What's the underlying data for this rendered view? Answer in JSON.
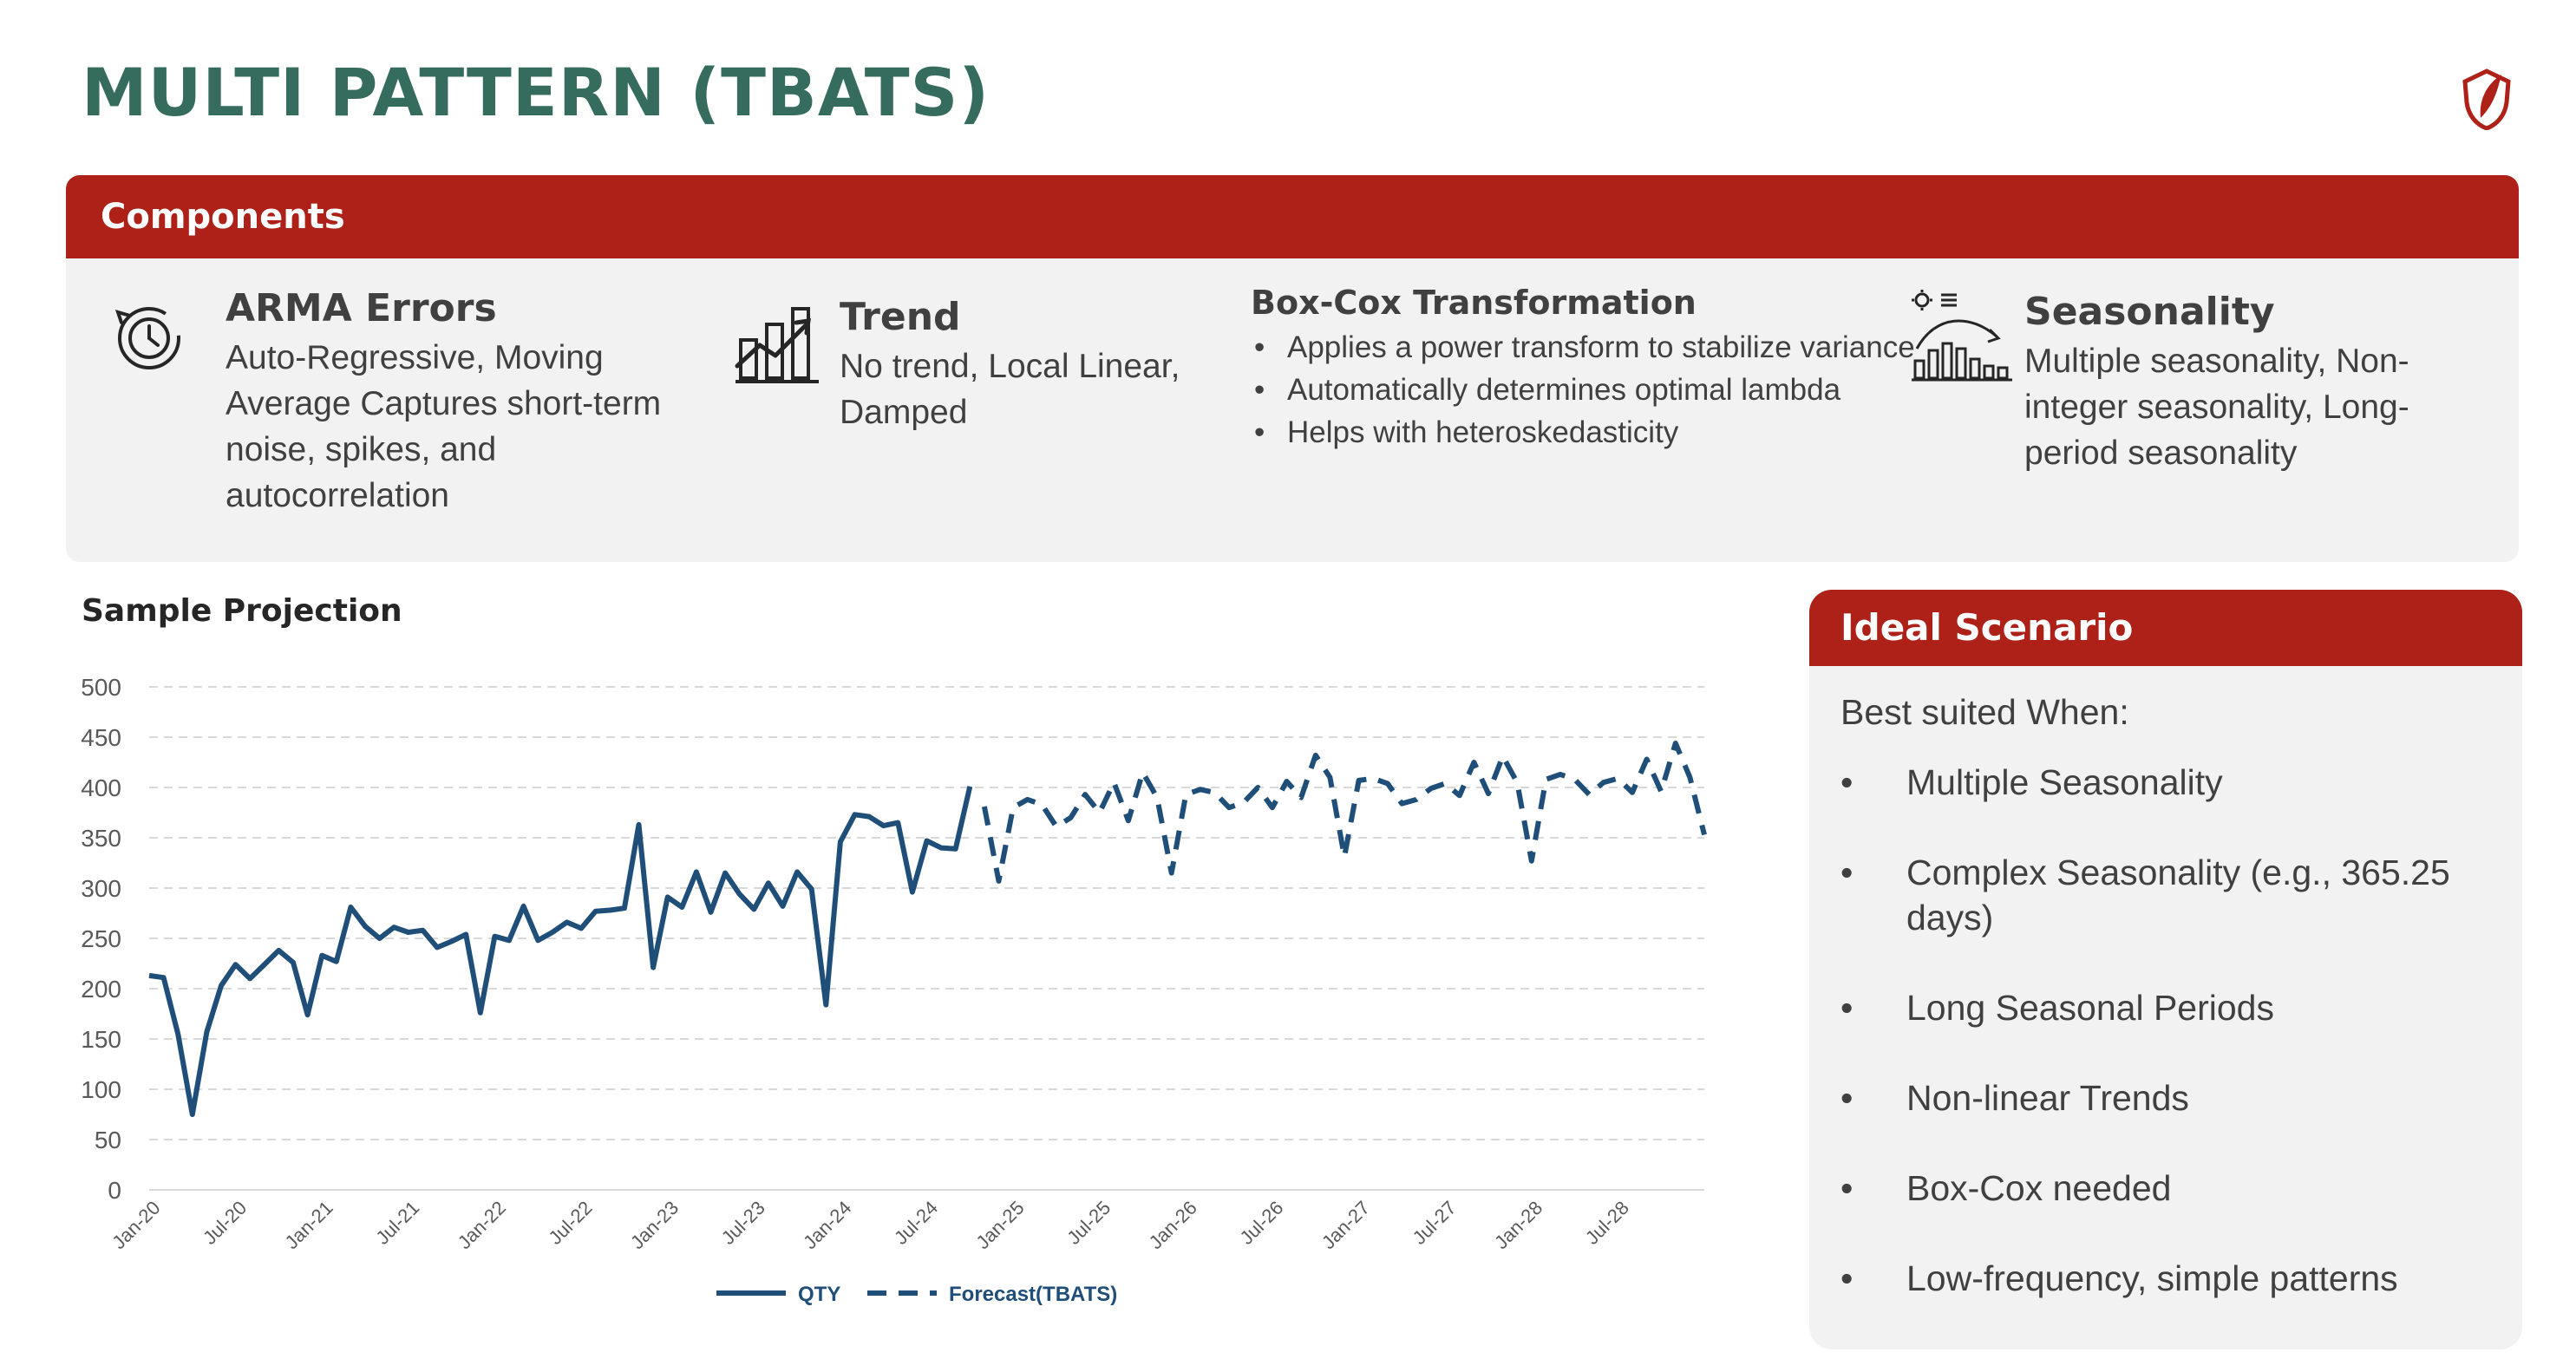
{
  "title": "MULTI PATTERN (TBATS)",
  "components": {
    "header": "Components",
    "arma": {
      "title": "ARMA Errors",
      "text": "Auto-Regressive, Moving Average Captures short-term noise, spikes, and autocorrelation",
      "icon": "clock-history-icon"
    },
    "trend": {
      "title": "Trend",
      "text": "No trend, Local Linear, Damped",
      "icon": "growth-chart-icon"
    },
    "boxcox": {
      "title": "Box-Cox Transformation",
      "bullets": [
        "Applies a power transform to stabilize variance",
        "Automatically determines optimal lambda",
        "Helps with heteroskedasticity"
      ]
    },
    "seasonality": {
      "title": "Seasonality",
      "text": "Multiple seasonality, Non-integer seasonality, Long-period seasonality",
      "icon": "seasonal-bars-icon"
    }
  },
  "projection_title": "Sample Projection",
  "ideal": {
    "header": "Ideal Scenario",
    "intro": "Best suited When:",
    "items": [
      "Multiple Seasonality",
      "Complex Seasonality (e.g., 365.25 days)",
      "Long Seasonal Periods",
      "Non-linear Trends",
      "Box-Cox needed",
      "Low-frequency, simple patterns"
    ]
  },
  "colors": {
    "title_green": "#356c5e",
    "header_red": "#ae2119",
    "panel_gray": "#f2f2f2",
    "series_blue": "#1f4e79",
    "axis_text": "#595959"
  },
  "chart_data": {
    "type": "line",
    "title": "",
    "xlabel": "",
    "ylabel": "",
    "ylim": [
      0,
      500
    ],
    "yticks": [
      0,
      50,
      100,
      150,
      200,
      250,
      300,
      350,
      400,
      450,
      500
    ],
    "grid": true,
    "legend_position": "bottom",
    "x_tick_labels": [
      "Jan-20",
      "Jul-20",
      "Jan-21",
      "Jul-21",
      "Jan-22",
      "Jul-22",
      "Jan-23",
      "Jul-23",
      "Jan-24",
      "Jul-24",
      "Jan-25",
      "Jul-25",
      "Jan-26",
      "Jul-26",
      "Jan-27",
      "Jul-27",
      "Jan-28",
      "Jul-28"
    ],
    "x_start": "Jan-20",
    "x_frequency": "monthly",
    "series": [
      {
        "name": "QTY",
        "style": "solid",
        "color": "#1f4e79",
        "start": "Jan-20",
        "values": [
          213,
          211,
          155,
          75,
          157,
          203,
          224,
          210,
          224,
          238,
          226,
          174,
          233,
          227,
          281,
          262,
          250,
          261,
          256,
          258,
          241,
          247,
          254,
          176,
          252,
          248,
          282,
          248,
          256,
          266,
          260,
          277,
          278,
          280,
          363,
          221,
          291,
          281,
          316,
          276,
          315,
          294,
          279,
          305,
          282,
          316,
          299,
          184,
          346,
          373,
          371,
          362,
          365,
          296,
          347,
          340,
          339,
          401
        ]
      },
      {
        "name": "Forecast(TBATS)",
        "style": "dashed",
        "color": "#1f4e79",
        "start": "Nov-24",
        "values": [
          381,
          307,
          380,
          388,
          383,
          361,
          370,
          393,
          375,
          405,
          367,
          415,
          390,
          315,
          393,
          398,
          395,
          380,
          385,
          400,
          380,
          406,
          390,
          432,
          410,
          331,
          407,
          409,
          404,
          384,
          388,
          399,
          404,
          392,
          425,
          394,
          431,
          405,
          327,
          408,
          413,
          408,
          393,
          405,
          409,
          395,
          428,
          396,
          444,
          410,
          353
        ]
      }
    ]
  }
}
